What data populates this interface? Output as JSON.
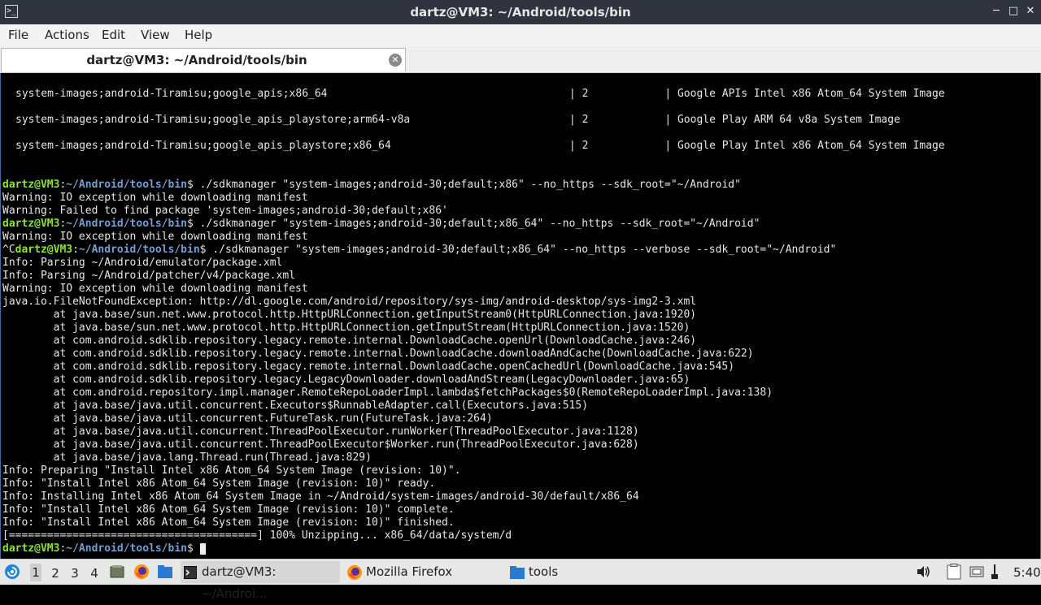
{
  "window": {
    "title": "dartz@VM3: ~/Android/tools/bin",
    "terminal_icon": ">_"
  },
  "menu": [
    "File",
    "Actions",
    "Edit",
    "View",
    "Help"
  ],
  "tab": {
    "label": "dartz@VM3: ~/Android/tools/bin"
  },
  "prompt": {
    "user": "dartz@VM3",
    "path": "~/Android/tools/bin"
  },
  "terminal": {
    "rows": [
      "system-images;android-Tiramisu;google_apis;x86_64                                      | 2            | Google APIs Intel x86 Atom_64 System Image",
      "system-images;android-Tiramisu;google_apis_playstore;arm64-v8a                         | 2            | Google Play ARM 64 v8a System Image",
      "system-images;android-Tiramisu;google_apis_playstore;x86_64                            | 2            | Google Play Intel x86 Atom_64 System Image"
    ],
    "cmd1": "$ ./sdkmanager \"system-images;android-30;default;x86\" --no_https --sdk_root=\"~/Android\"",
    "out1a": "Warning: IO exception while downloading manifest",
    "out1b": "Warning: Failed to find package 'system-images;android-30;default;x86'",
    "cmd2": "$ ./sdkmanager \"system-images;android-30;default;x86_64\" --no_https --sdk_root=\"~/Android\"",
    "out2": "Warning: IO exception while downloading manifest",
    "ctrlc": "^C",
    "cmd3": "$ ./sdkmanager \"system-images;android-30;default;x86_64\" --no_https --verbose --sdk_root=\"~/Android\"",
    "output": [
      "Info: Parsing ~/Android/emulator/package.xml",
      "Info: Parsing ~/Android/patcher/v4/package.xml",
      "Warning: IO exception while downloading manifest",
      "java.io.FileNotFoundException: http://dl.google.com/android/repository/sys-img/android-desktop/sys-img2-3.xml",
      "        at java.base/sun.net.www.protocol.http.HttpURLConnection.getInputStream0(HttpURLConnection.java:1920)",
      "        at java.base/sun.net.www.protocol.http.HttpURLConnection.getInputStream(HttpURLConnection.java:1520)",
      "        at com.android.sdklib.repository.legacy.remote.internal.DownloadCache.openUrl(DownloadCache.java:246)",
      "        at com.android.sdklib.repository.legacy.remote.internal.DownloadCache.downloadAndCache(DownloadCache.java:622)",
      "        at com.android.sdklib.repository.legacy.remote.internal.DownloadCache.openCachedUrl(DownloadCache.java:545)",
      "        at com.android.sdklib.repository.legacy.LegacyDownloader.downloadAndStream(LegacyDownloader.java:65)",
      "        at com.android.repository.impl.manager.RemoteRepoLoaderImpl.lambda$fetchPackages$0(RemoteRepoLoaderImpl.java:138)",
      "        at java.base/java.util.concurrent.Executors$RunnableAdapter.call(Executors.java:515)",
      "        at java.base/java.util.concurrent.FutureTask.run(FutureTask.java:264)",
      "        at java.base/java.util.concurrent.ThreadPoolExecutor.runWorker(ThreadPoolExecutor.java:1128)",
      "        at java.base/java.util.concurrent.ThreadPoolExecutor$Worker.run(ThreadPoolExecutor.java:628)",
      "        at java.base/java.lang.Thread.run(Thread.java:829)",
      "Info: Preparing \"Install Intel x86 Atom_64 System Image (revision: 10)\".",
      "Info: \"Install Intel x86 Atom_64 System Image (revision: 10)\" ready.",
      "Info: Installing Intel x86 Atom_64 System Image in ~/Android/system-images/android-30/default/x86_64",
      "Info: \"Install Intel x86 Atom_64 System Image (revision: 10)\" complete.",
      "Info: \"Install Intel x86 Atom_64 System Image (revision: 10)\" finished.",
      "[=======================================] 100% Unzipping... x86_64/data/system/d"
    ],
    "final_prompt_suffix": "$ "
  },
  "taskbar": {
    "workspaces": [
      "1",
      "2",
      "3",
      "4"
    ],
    "active_workspace": "1",
    "tasks": [
      {
        "label": "dartz@VM3: ~/Androi...",
        "icon": "terminal-icon"
      },
      {
        "label": "Mozilla Firefox",
        "icon": "firefox-icon"
      },
      {
        "label": "tools",
        "icon": "folder-icon"
      }
    ],
    "clock": "5:40"
  },
  "colors": {
    "prompt_user": "#8ae234",
    "prompt_path": "#729fcf",
    "terminal_bg": "#000000",
    "titlebar_bg": "#2f343f"
  }
}
